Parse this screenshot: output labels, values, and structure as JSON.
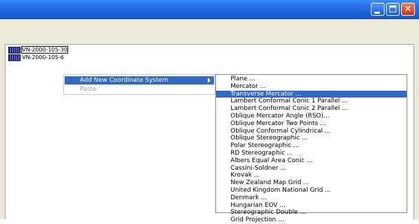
{
  "window": {
    "controls": [
      "minimize-icon",
      "maximize-icon",
      "close-icon"
    ],
    "close_glyph": "✕"
  },
  "tree": {
    "items": [
      {
        "label": "VN-2000-105-30",
        "selected": true
      },
      {
        "label": "VN-2000-105-6",
        "selected": false
      }
    ]
  },
  "context_menu": {
    "items": [
      {
        "label": "Add New Coordinate System",
        "highlighted": true,
        "has_submenu": true
      },
      {
        "label": "Paste",
        "disabled": true
      }
    ]
  },
  "submenu": {
    "highlighted_index": 2,
    "items": [
      "Plane ...",
      "Mercator ...",
      "Transverse Mercator ...",
      "Lambert Conformal Conic 1 Parallel ...",
      "Lambert Conformal Conic 2 Parallel ...",
      "Oblique Mercator Angle (RSO)...",
      "Oblique Mercator Two Points ...",
      "Oblique Conformal Cylindrical ...",
      "Oblique Stereographic ...",
      "Polar Stereographic ...",
      "RD Stereographic ...",
      "Albers Equal Area Conic ...",
      "Cassini-Soldner ...",
      "Krovak ...",
      "New Zealand Map Grid ...",
      "United Kingdom National Grid ...",
      "Denmark ...",
      "Hungarian EOV ...",
      "Stereographic Double ...",
      "Grid Projection ..."
    ]
  },
  "colors": {
    "title_bar": "#2a72e6",
    "highlight": "#316ac5",
    "chrome": "#ece9d8"
  }
}
